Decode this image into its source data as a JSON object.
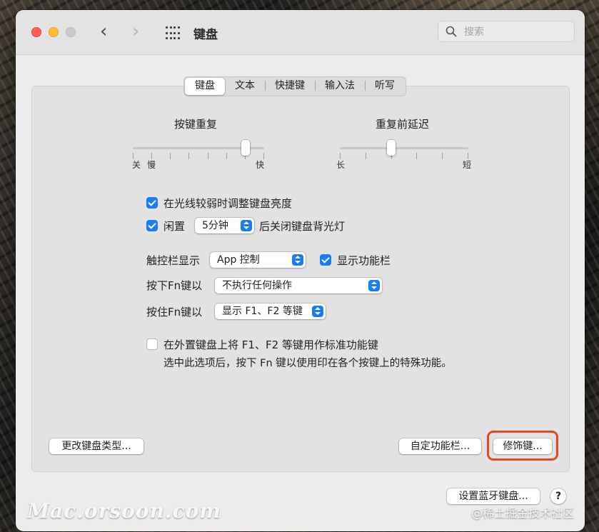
{
  "window": {
    "title": "键盘",
    "search_placeholder": "搜索"
  },
  "tabs": [
    {
      "label": "键盘",
      "active": true
    },
    {
      "label": "文本",
      "active": false
    },
    {
      "label": "快捷键",
      "active": false
    },
    {
      "label": "输入法",
      "active": false
    },
    {
      "label": "听写",
      "active": false
    }
  ],
  "key_repeat": {
    "title": "按键重复",
    "min_label": "关",
    "slow_label": "慢",
    "max_label": "快",
    "ticks": 8,
    "level": 0.86
  },
  "delay_until_repeat": {
    "title": "重复前延迟",
    "min_label": "长",
    "max_label": "短",
    "ticks": 6,
    "level": 0.4
  },
  "options": {
    "adjust_brightness": {
      "label": "在光线较弱时调整键盘亮度",
      "checked": true
    },
    "idle_backlight": {
      "checked": true,
      "prefix": "闲置",
      "selected": "5分钟",
      "suffix": "后关闭键盘背光灯"
    },
    "touch_bar": {
      "label": "触控栏显示",
      "selected": "App 控制"
    },
    "show_control_strip": {
      "label": "显示功能栏",
      "checked": true
    },
    "press_fn": {
      "label": "按下Fn键以",
      "selected": "不执行任何操作"
    },
    "hold_fn": {
      "label": "按住Fn键以",
      "selected": "显示 F1、F2 等键"
    },
    "standard_function_keys": {
      "checked": false,
      "label": "在外置键盘上将 F1、F2 等键用作标准功能键",
      "description": "选中此选项后，按下 Fn 键以使用印在各个按键上的特殊功能。"
    }
  },
  "buttons": {
    "change_keyboard_type": "更改键盘类型...",
    "customize_control_strip": "自定功能栏...",
    "modifier_keys": "修饰键...",
    "setup_bluetooth_keyboard": "设置蓝牙键盘...",
    "help": "?"
  },
  "watermarks": {
    "left": "Mac.orsoon.com",
    "right": "@稀土掘金技术社区"
  },
  "colors": {
    "accent": "#1a7cf3",
    "highlight": "#e8452a",
    "close": "#ff5f57",
    "minimize": "#febc2e"
  }
}
